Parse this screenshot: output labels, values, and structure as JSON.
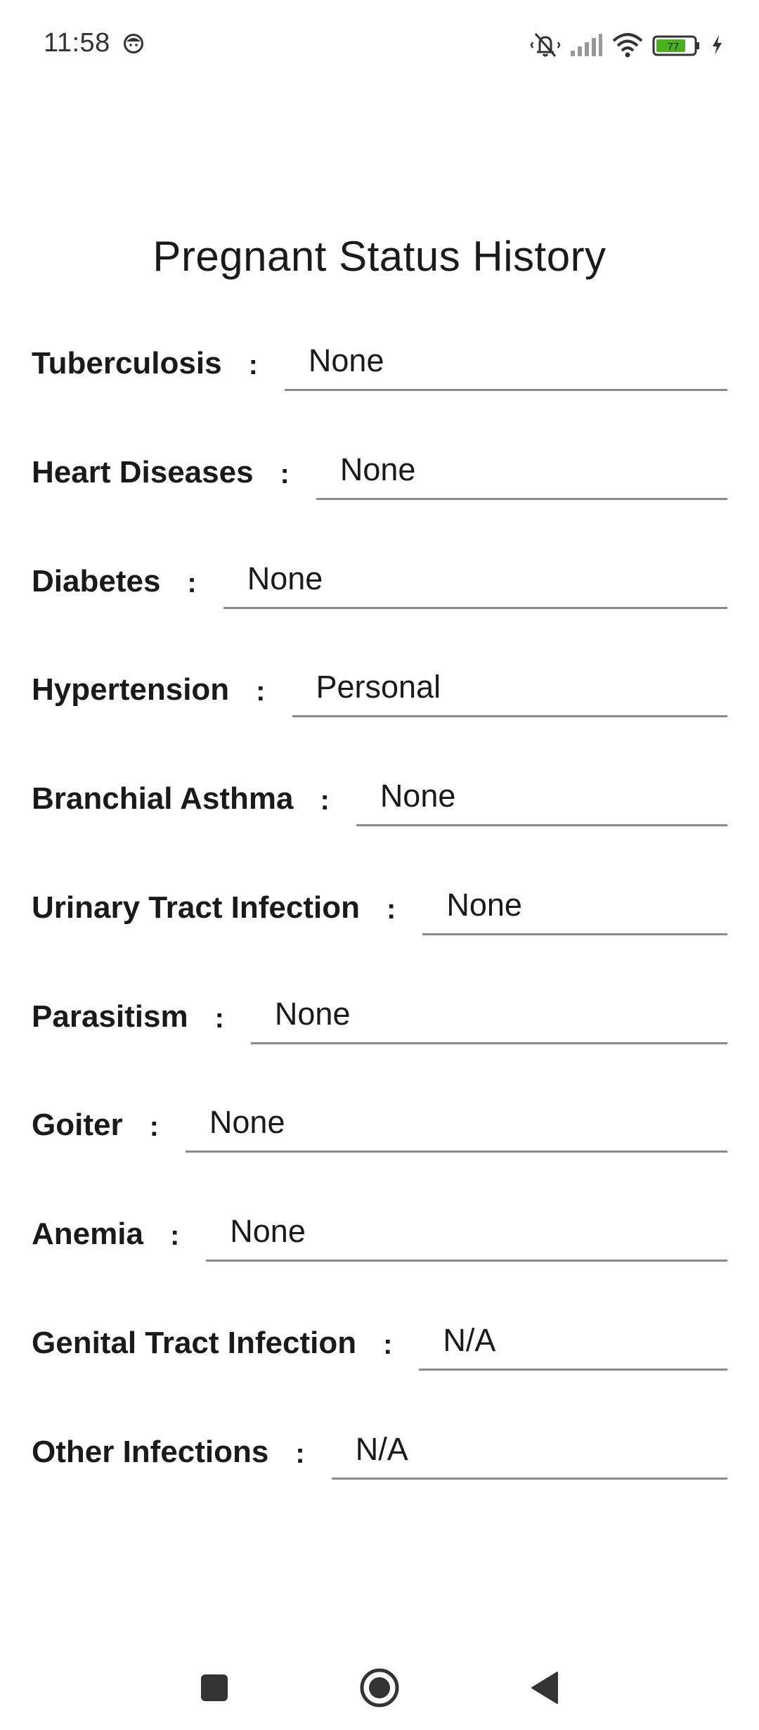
{
  "status_bar": {
    "time": "11:58",
    "battery_level": "77",
    "icons": [
      "face-icon",
      "mute-vibrate-icon",
      "signal-icon",
      "wifi-icon",
      "battery-icon",
      "charging-icon"
    ],
    "battery_color": "#4caf1e"
  },
  "page": {
    "title": "Pregnant Status History"
  },
  "rows": [
    {
      "label": "Tuberculosis",
      "colon": ":",
      "value": "None"
    },
    {
      "label": "Heart Diseases",
      "colon": ":",
      "value": "None"
    },
    {
      "label": "Diabetes",
      "colon": ":",
      "value": "None"
    },
    {
      "label": "Hypertension",
      "colon": ":",
      "value": "Personal"
    },
    {
      "label": "Branchial Asthma",
      "colon": ":",
      "value": "None"
    },
    {
      "label": "Urinary Tract Infection",
      "colon": ":",
      "value": "None"
    },
    {
      "label": "Parasitism",
      "colon": ":",
      "value": "None"
    },
    {
      "label": "Goiter",
      "colon": ":",
      "value": "None"
    },
    {
      "label": "Anemia",
      "colon": ":",
      "value": "None"
    },
    {
      "label": "Genital Tract Infection",
      "colon": ":",
      "value": "N/A"
    },
    {
      "label": "Other Infections",
      "colon": ":",
      "value": "N/A"
    }
  ],
  "nav_bar": {
    "buttons": [
      "recents-icon",
      "home-icon",
      "back-icon"
    ]
  }
}
